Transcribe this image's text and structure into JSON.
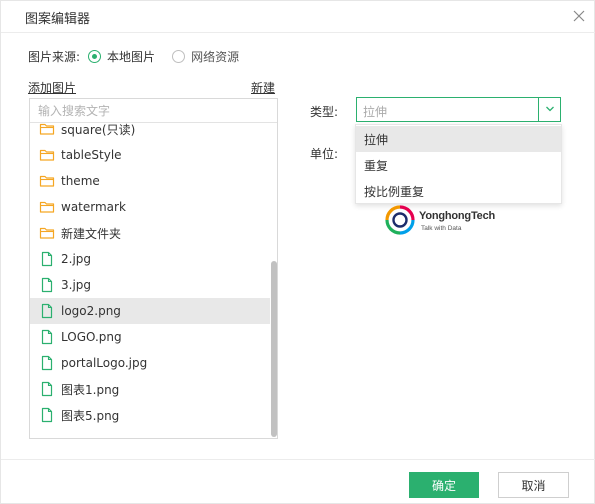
{
  "dialog": {
    "title": "图案编辑器",
    "close_icon": "close-icon"
  },
  "source": {
    "label": "图片来源:",
    "options": [
      {
        "label": "本地图片",
        "checked": true
      },
      {
        "label": "网络资源",
        "checked": false
      }
    ]
  },
  "links": {
    "add": "添加图片",
    "new": "新建"
  },
  "search": {
    "placeholder": "输入搜索文字"
  },
  "files": [
    {
      "name": "square(只读)",
      "kind": "folder",
      "selected": false
    },
    {
      "name": "tableStyle",
      "kind": "folder",
      "selected": false
    },
    {
      "name": "theme",
      "kind": "folder",
      "selected": false
    },
    {
      "name": "watermark",
      "kind": "folder",
      "selected": false
    },
    {
      "name": "新建文件夹",
      "kind": "folder",
      "selected": false
    },
    {
      "name": "2.jpg",
      "kind": "file",
      "selected": false
    },
    {
      "name": "3.jpg",
      "kind": "file",
      "selected": false
    },
    {
      "name": "logo2.png",
      "kind": "file",
      "selected": true
    },
    {
      "name": "LOGO.png",
      "kind": "file",
      "selected": false
    },
    {
      "name": "portalLogo.jpg",
      "kind": "file",
      "selected": false
    },
    {
      "name": "图表1.png",
      "kind": "file",
      "selected": false
    },
    {
      "name": "图表5.png",
      "kind": "file",
      "selected": false
    }
  ],
  "settings": {
    "type_label": "类型:",
    "unit_label": "单位:",
    "type_value": "拉伸",
    "type_options": [
      "拉伸",
      "重复",
      "按比例重复"
    ],
    "type_active_index": 0
  },
  "preview": {
    "logo_main": "YonghongTech",
    "logo_sub": "Talk with Data"
  },
  "footer": {
    "ok": "确定",
    "cancel": "取消"
  },
  "colors": {
    "accent": "#2bb06f",
    "folder": "#f5a623",
    "file": "#2bb06f",
    "selected_row": "#e8e8e8"
  }
}
